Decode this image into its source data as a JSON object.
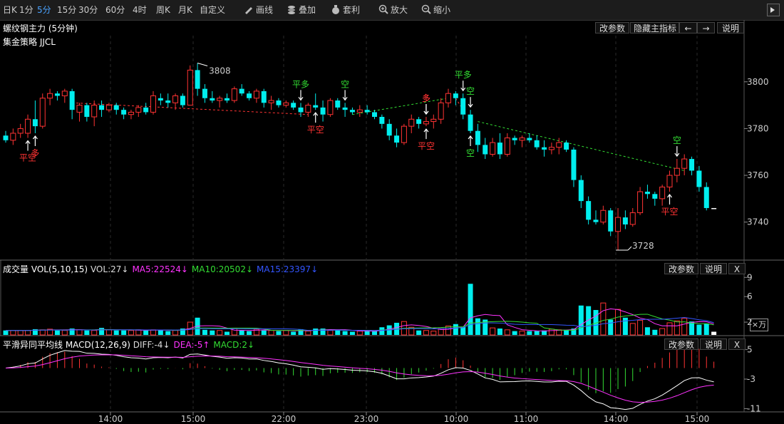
{
  "toolbar": {
    "items": [
      {
        "label": "日K",
        "icon": ""
      },
      {
        "label": "1分",
        "icon": ""
      },
      {
        "label": "5分",
        "icon": "",
        "active": true
      },
      {
        "label": "15分",
        "icon": ""
      },
      {
        "label": "30分",
        "icon": ""
      },
      {
        "label": "60分",
        "icon": ""
      },
      {
        "label": "4时",
        "icon": ""
      },
      {
        "label": "周K",
        "icon": ""
      },
      {
        "label": "月K",
        "icon": ""
      },
      {
        "label": "自定义",
        "icon": ""
      },
      {
        "label": "画线",
        "icon": "pencil-icon"
      },
      {
        "label": "叠加",
        "icon": "stack-icon"
      },
      {
        "label": "套利",
        "icon": "money-bag-icon"
      },
      {
        "label": "放大",
        "icon": "zoom-in-icon"
      },
      {
        "label": "缩小",
        "icon": "zoom-out-icon"
      }
    ]
  },
  "main_panel": {
    "title": "螺纹钢主力 (5分钟)",
    "strategy": "集金策略 JJCL",
    "buttons": [
      "改参数",
      "隐藏主指标",
      "←",
      "→",
      "说明"
    ],
    "high_label": "3808",
    "low_label": "3728",
    "y_ticks": [
      "3800",
      "3780",
      "3760",
      "3740"
    ],
    "signals_up": [
      "多",
      "平多",
      "空",
      "多",
      "平多",
      "空",
      "空"
    ],
    "signals_down": [
      "平空",
      "多",
      "平空",
      "平空",
      "空",
      "平空"
    ]
  },
  "vol_panel": {
    "label": "成交量 VOL(5,10,15)",
    "items": [
      {
        "text": "VOL:27↓",
        "color": "#dddddd"
      },
      {
        "text": "MA5:22524↓",
        "color": "#ff33ff"
      },
      {
        "text": "MA10:20502↓",
        "color": "#33dd33"
      },
      {
        "text": "MA15:23397↓",
        "color": "#3355ff"
      }
    ],
    "buttons": [
      "改参数",
      "说明",
      "X"
    ],
    "y_ticks": [
      "9",
      "6",
      "2"
    ],
    "unit_label": "×万"
  },
  "macd_panel": {
    "label": "平滑异同平均线 MACD(12,26,9)",
    "items": [
      {
        "text": "DIFF:-4↓",
        "color": "#dddddd"
      },
      {
        "text": "DEA:-5↑",
        "color": "#ff33ff"
      },
      {
        "text": "MACD:2↓",
        "color": "#33dd33"
      }
    ],
    "buttons": [
      "改参数",
      "说明",
      "X"
    ],
    "y_ticks": [
      "5",
      "-3",
      "-11"
    ]
  },
  "x_axis": {
    "labels": [
      "14:00",
      "15:00",
      "22:00",
      "23:00",
      "10:00",
      "11:00",
      "14:00",
      "15:00"
    ]
  },
  "colors": {
    "up": "#ff3333",
    "down": "#00eeee",
    "doji": "#ffffff",
    "ma5": "#ff33ff",
    "ma10": "#33dd33",
    "ma15": "#3355ff",
    "buy": "#ff3333",
    "sell": "#33dd33"
  },
  "chart_data": {
    "type": "candlestick",
    "title": "螺纹钢主力 (5分钟)",
    "ohlc": [
      [
        3777,
        3779,
        3774,
        3775
      ],
      [
        3775,
        3780,
        3773,
        3778
      ],
      [
        3778,
        3782,
        3776,
        3780
      ],
      [
        3778,
        3786,
        3776,
        3784
      ],
      [
        3784,
        3792,
        3778,
        3781
      ],
      [
        3781,
        3795,
        3780,
        3793
      ],
      [
        3793,
        3797,
        3790,
        3795
      ],
      [
        3795,
        3796,
        3792,
        3794
      ],
      [
        3794,
        3797,
        3791,
        3796
      ],
      [
        3796,
        3797,
        3784,
        3788
      ],
      [
        3787,
        3791,
        3783,
        3790
      ],
      [
        3790,
        3791,
        3783,
        3785
      ],
      [
        3785,
        3792,
        3781,
        3790
      ],
      [
        3790,
        3792,
        3785,
        3788
      ],
      [
        3788,
        3791,
        3787,
        3790
      ],
      [
        3790,
        3791,
        3786,
        3788
      ],
      [
        3788,
        3789,
        3784,
        3786
      ],
      [
        3786,
        3788,
        3784,
        3787
      ],
      [
        3787,
        3790,
        3785,
        3789
      ],
      [
        3789,
        3791,
        3786,
        3787
      ],
      [
        3787,
        3796,
        3786,
        3794
      ],
      [
        3793,
        3795,
        3790,
        3792
      ],
      [
        3792,
        3795,
        3789,
        3791
      ],
      [
        3791,
        3795,
        3788,
        3794
      ],
      [
        3794,
        3795,
        3789,
        3790
      ],
      [
        3790,
        3807,
        3790,
        3805
      ],
      [
        3805,
        3808,
        3794,
        3797
      ],
      [
        3797,
        3799,
        3791,
        3793
      ],
      [
        3793,
        3796,
        3791,
        3792
      ],
      [
        3792,
        3794,
        3789,
        3793
      ],
      [
        3793,
        3795,
        3791,
        3792
      ],
      [
        3792,
        3798,
        3791,
        3797
      ],
      [
        3797,
        3799,
        3794,
        3795
      ],
      [
        3795,
        3796,
        3792,
        3793
      ],
      [
        3793,
        3797,
        3791,
        3796
      ],
      [
        3796,
        3797,
        3789,
        3791
      ],
      [
        3791,
        3794,
        3788,
        3792
      ],
      [
        3792,
        3793,
        3789,
        3790
      ],
      [
        3790,
        3792,
        3789,
        3791
      ],
      [
        3791,
        3792,
        3788,
        3789
      ],
      [
        3789,
        3791,
        3785,
        3787
      ],
      [
        3787,
        3791,
        3785,
        3790
      ],
      [
        3790,
        3795,
        3788,
        3789
      ],
      [
        3789,
        3792,
        3783,
        3786
      ],
      [
        3786,
        3793,
        3785,
        3792
      ],
      [
        3792,
        3793,
        3788,
        3789
      ],
      [
        3789,
        3791,
        3785,
        3788
      ],
      [
        3788,
        3789,
        3786,
        3787
      ],
      [
        3787,
        3790,
        3785,
        3788
      ],
      [
        3788,
        3790,
        3786,
        3787
      ],
      [
        3787,
        3788,
        3784,
        3785
      ],
      [
        3785,
        3786,
        3780,
        3782
      ],
      [
        3782,
        3784,
        3775,
        3777
      ],
      [
        3777,
        3780,
        3772,
        3774
      ],
      [
        3774,
        3782,
        3773,
        3781
      ],
      [
        3781,
        3786,
        3778,
        3784
      ],
      [
        3784,
        3785,
        3780,
        3782
      ],
      [
        3782,
        3785,
        3781,
        3783
      ],
      [
        3783,
        3786,
        3780,
        3784
      ],
      [
        3784,
        3793,
        3782,
        3791
      ],
      [
        3791,
        3797,
        3789,
        3795
      ],
      [
        3795,
        3796,
        3790,
        3793
      ],
      [
        3793,
        3795,
        3784,
        3786
      ],
      [
        3786,
        3788,
        3778,
        3779
      ],
      [
        3779,
        3782,
        3770,
        3773
      ],
      [
        3773,
        3776,
        3767,
        3769
      ],
      [
        3769,
        3776,
        3768,
        3774
      ],
      [
        3774,
        3778,
        3767,
        3769
      ],
      [
        3769,
        3778,
        3768,
        3776
      ],
      [
        3776,
        3777,
        3773,
        3775
      ],
      [
        3775,
        3777,
        3772,
        3776
      ],
      [
        3776,
        3778,
        3774,
        3775
      ],
      [
        3775,
        3777,
        3771,
        3772
      ],
      [
        3772,
        3775,
        3768,
        3771
      ],
      [
        3771,
        3774,
        3769,
        3772
      ],
      [
        3772,
        3776,
        3769,
        3774
      ],
      [
        3774,
        3775,
        3770,
        3771
      ],
      [
        3771,
        3772,
        3755,
        3758
      ],
      [
        3758,
        3760,
        3746,
        3749
      ],
      [
        3749,
        3751,
        3739,
        3741
      ],
      [
        3741,
        3745,
        3739,
        3740
      ],
      [
        3740,
        3747,
        3739,
        3745
      ],
      [
        3745,
        3746,
        3734,
        3736
      ],
      [
        3736,
        3746,
        3728,
        3742
      ],
      [
        3742,
        3745,
        3737,
        3739
      ],
      [
        3739,
        3746,
        3738,
        3744
      ],
      [
        3744,
        3755,
        3743,
        3753
      ],
      [
        3753,
        3756,
        3750,
        3752
      ],
      [
        3752,
        3753,
        3747,
        3750
      ],
      [
        3750,
        3756,
        3747,
        3755
      ],
      [
        3755,
        3762,
        3753,
        3760
      ],
      [
        3760,
        3767,
        3757,
        3763
      ],
      [
        3763,
        3769,
        3760,
        3767
      ],
      [
        3767,
        3768,
        3760,
        3762
      ],
      [
        3762,
        3764,
        3753,
        3755
      ],
      [
        3755,
        3757,
        3745,
        3746
      ],
      [
        3746,
        3746,
        3746,
        3746
      ]
    ],
    "volume": [
      0.7,
      0.7,
      0.7,
      0.7,
      0.9,
      0.8,
      0.9,
      0.7,
      0.7,
      1.0,
      0.8,
      0.7,
      0.7,
      1.1,
      0.8,
      0.7,
      0.7,
      0.7,
      0.8,
      0.7,
      0.8,
      0.8,
      0.6,
      0.7,
      1.0,
      2.0,
      2.7,
      0.8,
      0.7,
      0.7,
      0.5,
      1.0,
      0.7,
      0.6,
      0.9,
      0.7,
      0.7,
      0.6,
      0.7,
      0.5,
      0.9,
      0.6,
      1.0,
      1.0,
      0.7,
      0.8,
      0.6,
      0.5,
      0.6,
      0.6,
      0.6,
      1.2,
      1.5,
      1.9,
      2.1,
      1.2,
      0.7,
      0.7,
      0.6,
      1.0,
      1.4,
      1.7,
      1.3,
      8.0,
      2.6,
      2.4,
      1.1,
      1.0,
      0.8,
      0.6,
      0.6,
      0.6,
      0.6,
      0.7,
      0.9,
      0.8,
      0.8,
      1.0,
      4.6,
      4.5,
      3.9,
      5.0,
      2.4,
      4.0,
      2.7,
      1.8,
      2.3,
      1.2,
      0.8,
      1.0,
      1.9,
      2.2,
      2.6,
      2.1,
      1.6,
      1.8,
      0.5
    ],
    "ylim": [
      3721,
      3817
    ],
    "vol_ylim": [
      0,
      9.7
    ],
    "macd_ylim": [
      -11.5,
      5.5
    ],
    "dashed_lines": [
      {
        "from": [
          9,
          3791
        ],
        "to": [
          41,
          3786
        ],
        "color": "#ff3333"
      },
      {
        "from": [
          47,
          3786
        ],
        "to": [
          60,
          3793
        ],
        "color": "#33dd33"
      },
      {
        "from": [
          61,
          3793
        ],
        "to": [
          62,
          3788
        ],
        "color": "#ff3333"
      },
      {
        "from": [
          64,
          3783
        ],
        "to": [
          92,
          3762
        ],
        "color": "#33dd33"
      }
    ]
  }
}
